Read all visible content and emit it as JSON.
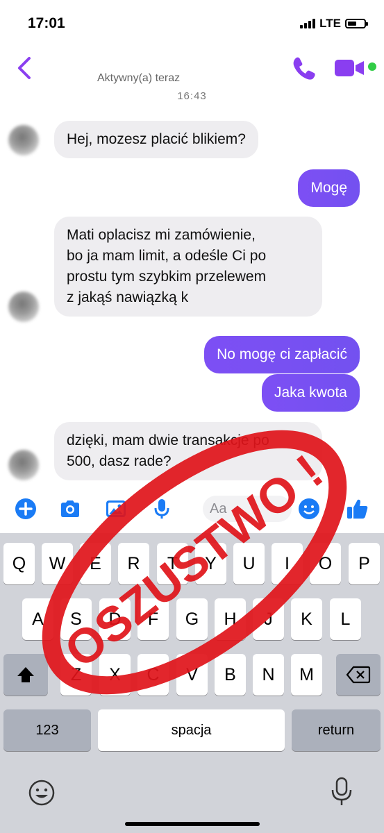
{
  "status_bar": {
    "time": "17:01",
    "network": "LTE"
  },
  "header": {
    "contact_name": "",
    "active_status": "Aktywny(a) teraz",
    "accent_color": "#8a3ef0"
  },
  "conversation": {
    "time_divider": "16:43",
    "messages": [
      {
        "direction": "incoming",
        "text": "Hej, mozesz placić blikiem?"
      },
      {
        "direction": "outgoing",
        "text": "Mogę"
      },
      {
        "direction": "incoming",
        "lines": [
          "Mati oplacisz mi zamówienie,",
          "bo ja mam limit, a odeśle Ci po",
          "prostu tym szybkim przelewem",
          "z jakąś nawiązką k"
        ]
      },
      {
        "direction": "outgoing",
        "text": "No mogę ci zapłacić"
      },
      {
        "direction": "outgoing",
        "text": "Jaka kwota"
      },
      {
        "direction": "incoming",
        "lines": [
          "dzięki, mam dwie transakcje po",
          "500, dasz rade?"
        ]
      }
    ]
  },
  "composer": {
    "placeholder": "Aa",
    "icons": [
      "plus-icon",
      "camera-icon",
      "image-icon",
      "microphone-icon",
      "emoji-icon",
      "thumbs-up-icon"
    ]
  },
  "keyboard": {
    "row1": [
      "Q",
      "W",
      "E",
      "R",
      "T",
      "Y",
      "U",
      "I",
      "O",
      "P"
    ],
    "row2": [
      "A",
      "S",
      "D",
      "F",
      "G",
      "H",
      "J",
      "K",
      "L"
    ],
    "row3": [
      "Z",
      "X",
      "C",
      "V",
      "B",
      "N",
      "M"
    ],
    "numbers_label": "123",
    "space_label": "spacja",
    "return_label": "return"
  },
  "overlay": {
    "stamp_text": "OSZUSTWO !",
    "stamp_color": "#e0141a"
  }
}
